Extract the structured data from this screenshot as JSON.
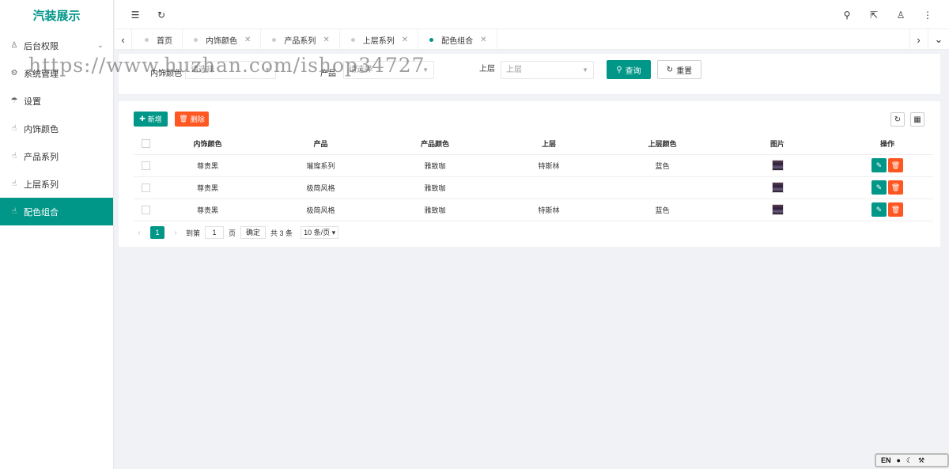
{
  "app": {
    "title": "汽装展示"
  },
  "sidebar": {
    "items": [
      {
        "label": "后台权限",
        "icon": "user-icon",
        "has_arrow": true
      },
      {
        "label": "系统管理",
        "icon": "gear-icon"
      },
      {
        "label": "设置",
        "icon": "umbrella-icon"
      },
      {
        "label": "内饰颜色",
        "icon": "hand-icon"
      },
      {
        "label": "产品系列",
        "icon": "hand-icon"
      },
      {
        "label": "上层系列",
        "icon": "hand-icon"
      },
      {
        "label": "配色组合",
        "icon": "hand-icon",
        "active": true
      }
    ]
  },
  "tabs": [
    {
      "label": "首页"
    },
    {
      "label": "内饰颜色"
    },
    {
      "label": "产品系列"
    },
    {
      "label": "上层系列"
    },
    {
      "label": "配色组合",
      "active": true
    }
  ],
  "search": {
    "label1": "内饰颜色",
    "select1_placeholder": "请选择",
    "label2": "产品",
    "select2_placeholder": "请选择",
    "label3": "上层",
    "select3_placeholder": "上层",
    "query_label": "查询",
    "reset_label": "重置"
  },
  "toolbar": {
    "add_label": "新增",
    "delete_label": "删除"
  },
  "table": {
    "columns": [
      "内饰颜色",
      "产品",
      "产品颜色",
      "上层",
      "上层颜色",
      "图片",
      "操作"
    ],
    "rows": [
      [
        "尊贵黑",
        "璀璨系列",
        "雅致咖",
        "特斯林",
        "蓝色"
      ],
      [
        "尊贵黑",
        "极简风格",
        "雅致咖",
        "",
        ""
      ],
      [
        "尊贵黑",
        "极简风格",
        "雅致咖",
        "特斯林",
        "蓝色"
      ]
    ]
  },
  "pager": {
    "current": "1",
    "goto_label": "到第",
    "goto_value": "1",
    "page_unit": "页",
    "confirm_label": "确定",
    "total_label": "共 3 条",
    "page_size": "10 条/页"
  },
  "watermark": {
    "text": "https://www.huzhan.com/ishop34727"
  },
  "ime": {
    "lang": "EN"
  },
  "colors": {
    "primary": "#009688",
    "danger": "#ff5722"
  }
}
